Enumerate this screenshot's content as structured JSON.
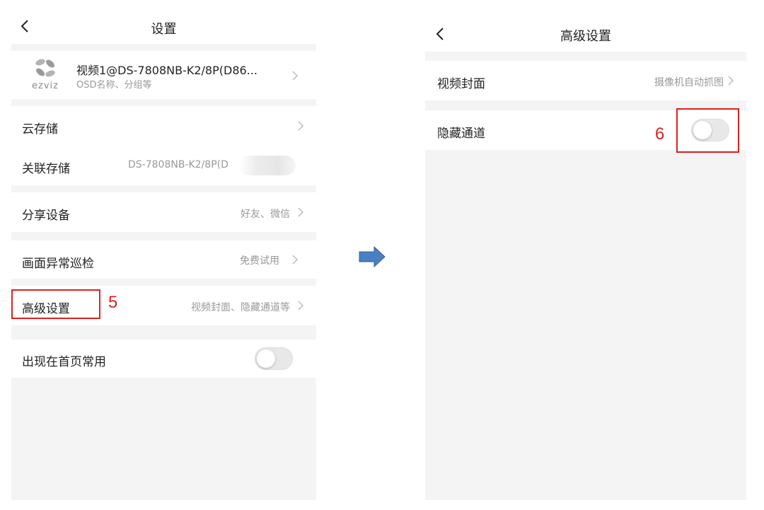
{
  "colors": {
    "annotation": "#e02020",
    "arrow": "#4a7fc1",
    "page_bg": "#f4f4f4",
    "row_bg": "#ffffff",
    "secondary_text": "#999999"
  },
  "left_screen": {
    "title": "设置",
    "back_icon": "chevron-left-icon",
    "device": {
      "logo_text": "ezviz",
      "name": "视频1@DS-7808NB-K2/8P(D86...",
      "subtitle": "OSD名称、分组等"
    },
    "cloud_storage": {
      "label": "云存储"
    },
    "linked_storage": {
      "label": "关联存储",
      "value": "DS-7808NB-K2/8P(D"
    },
    "share_device": {
      "label": "分享设备",
      "value": "好友、微信"
    },
    "image_patrol": {
      "label": "画面异常巡检",
      "value": "免费试用"
    },
    "advanced_settings": {
      "label": "高级设置",
      "value": "视频封面、隐藏通道等"
    },
    "show_on_home": {
      "label": "出现在首页常用",
      "toggle_on": false
    },
    "annotation_label": "5"
  },
  "right_screen": {
    "title": "高级设置",
    "back_icon": "chevron-left-icon",
    "video_cover": {
      "label": "视频封面",
      "value": "摄像机自动抓图"
    },
    "hidden_channel": {
      "label": "隐藏通道",
      "toggle_on": false
    },
    "annotation_label": "6"
  },
  "arrow_icon": "arrow-right-icon"
}
